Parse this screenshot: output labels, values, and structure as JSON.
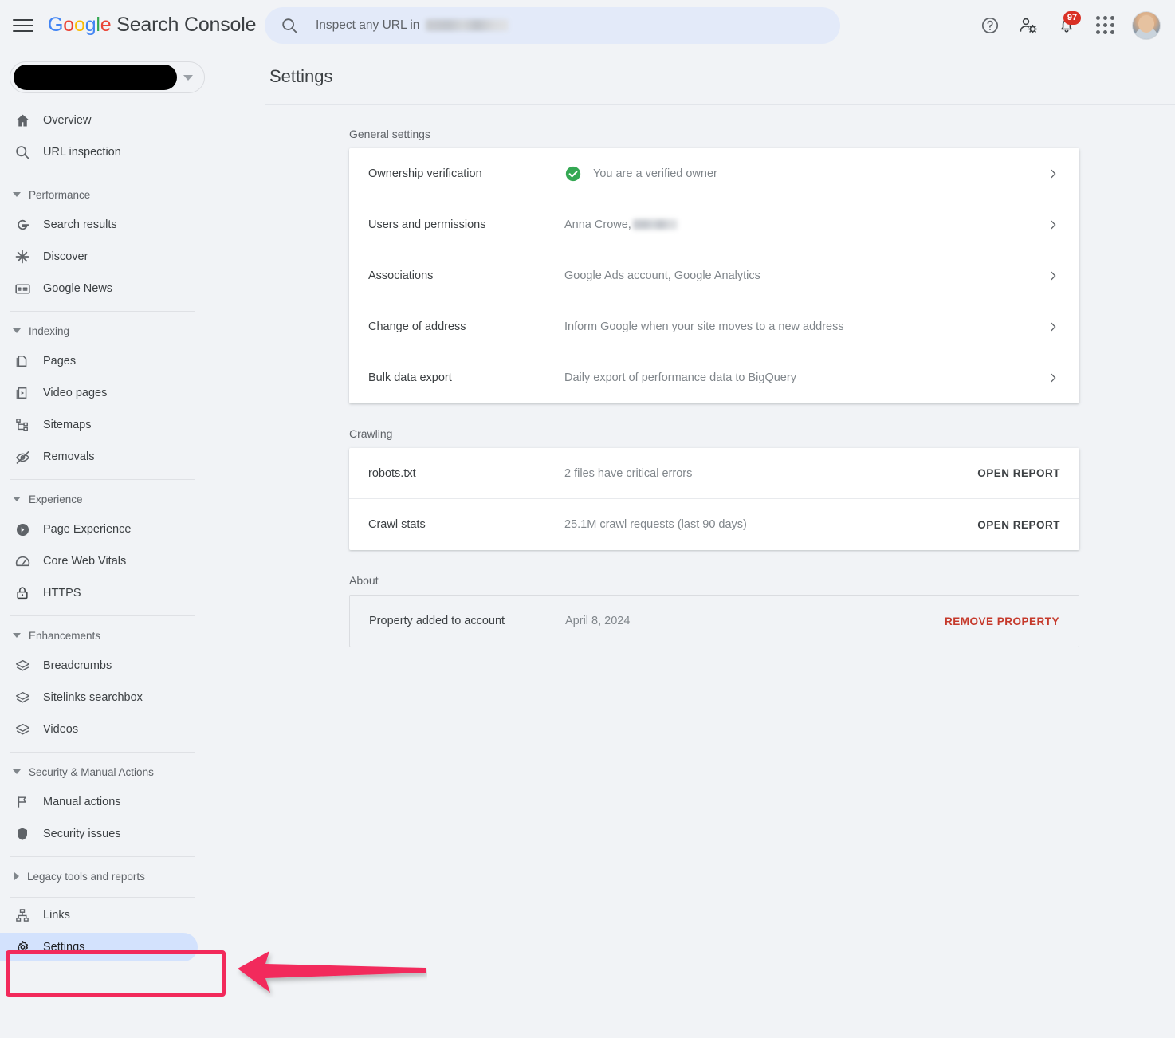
{
  "app": {
    "brand_google": "Google",
    "brand_suffix": " Search Console",
    "menu_icon": "hamburger-icon"
  },
  "search": {
    "placeholder": "Inspect any URL in",
    "icon": "search-icon",
    "redacted": true
  },
  "topbar_icons": {
    "help": "help-icon",
    "account_settings": "account-settings-icon",
    "notifications": "notifications-bell-icon",
    "notifications_count": "97",
    "apps": "apps-grid-icon",
    "avatar": "user-avatar"
  },
  "property_selector": {
    "label_redacted": true,
    "caret_icon": "chevron-down-icon"
  },
  "sidebar": {
    "top_items": [
      {
        "label": "Overview",
        "icon": "home-icon"
      },
      {
        "label": "URL inspection",
        "icon": "search-icon"
      }
    ],
    "groups": [
      {
        "label": "Performance",
        "expanded": true,
        "items": [
          {
            "label": "Search results",
            "icon": "google-g-icon"
          },
          {
            "label": "Discover",
            "icon": "asterisk-icon"
          },
          {
            "label": "Google News",
            "icon": "news-card-icon"
          }
        ]
      },
      {
        "label": "Indexing",
        "expanded": true,
        "items": [
          {
            "label": "Pages",
            "icon": "pages-icon"
          },
          {
            "label": "Video pages",
            "icon": "video-pages-icon"
          },
          {
            "label": "Sitemaps",
            "icon": "sitemap-icon"
          },
          {
            "label": "Removals",
            "icon": "eye-off-icon"
          }
        ]
      },
      {
        "label": "Experience",
        "expanded": true,
        "items": [
          {
            "label": "Page Experience",
            "icon": "page-experience-icon"
          },
          {
            "label": "Core Web Vitals",
            "icon": "speedometer-icon"
          },
          {
            "label": "HTTPS",
            "icon": "lock-icon"
          }
        ]
      },
      {
        "label": "Enhancements",
        "expanded": true,
        "items": [
          {
            "label": "Breadcrumbs",
            "icon": "layers-icon"
          },
          {
            "label": "Sitelinks searchbox",
            "icon": "layers-icon"
          },
          {
            "label": "Videos",
            "icon": "layers-icon"
          }
        ]
      },
      {
        "label": "Security & Manual Actions",
        "expanded": true,
        "items": [
          {
            "label": "Manual actions",
            "icon": "flag-icon"
          },
          {
            "label": "Security issues",
            "icon": "shield-icon"
          }
        ]
      },
      {
        "label": "Legacy tools and reports",
        "expanded": false,
        "items": []
      }
    ],
    "bottom_items": [
      {
        "label": "Links",
        "icon": "links-graph-icon",
        "active": false
      },
      {
        "label": "Settings",
        "icon": "gear-icon",
        "active": true
      }
    ]
  },
  "main": {
    "title": "Settings",
    "sections": [
      {
        "label": "General settings",
        "style": "card",
        "rows": [
          {
            "name": "Ownership verification",
            "value": "You are a verified owner",
            "status_icon": "verified-check-icon",
            "trailing": "chevron"
          },
          {
            "name": "Users and permissions",
            "value": "Anna Crowe,",
            "value_redacted": true,
            "trailing": "chevron"
          },
          {
            "name": "Associations",
            "value": "Google Ads account, Google Analytics",
            "trailing": "chevron"
          },
          {
            "name": "Change of address",
            "value": "Inform Google when your site moves to a new address",
            "trailing": "chevron"
          },
          {
            "name": "Bulk data export",
            "value": "Daily export of performance data to BigQuery",
            "trailing": "chevron"
          }
        ]
      },
      {
        "label": "Crawling",
        "style": "card",
        "rows": [
          {
            "name": "robots.txt",
            "value": "2 files have critical errors",
            "trailing": "action",
            "action_label": "OPEN REPORT"
          },
          {
            "name": "Crawl stats",
            "value": "25.1M crawl requests (last 90 days)",
            "trailing": "action",
            "action_label": "OPEN REPORT"
          }
        ]
      },
      {
        "label": "About",
        "style": "flat",
        "rows": [
          {
            "name": "Property added to account",
            "value": "April 8, 2024",
            "trailing": "action",
            "action_label": "REMOVE PROPERTY",
            "action_danger": true
          }
        ]
      }
    ]
  },
  "annotation": {
    "type": "highlight-box-and-arrow",
    "target": "Settings",
    "color": "#f2295b"
  },
  "colors": {
    "page_bg": "#f1f3f6",
    "accent_blue": "#d3e2fd",
    "search_bg": "#e3eaf9",
    "verified_green": "#34a853",
    "danger_red": "#c5392b",
    "badge_red": "#d93025",
    "annotation_pink": "#f2295b"
  }
}
